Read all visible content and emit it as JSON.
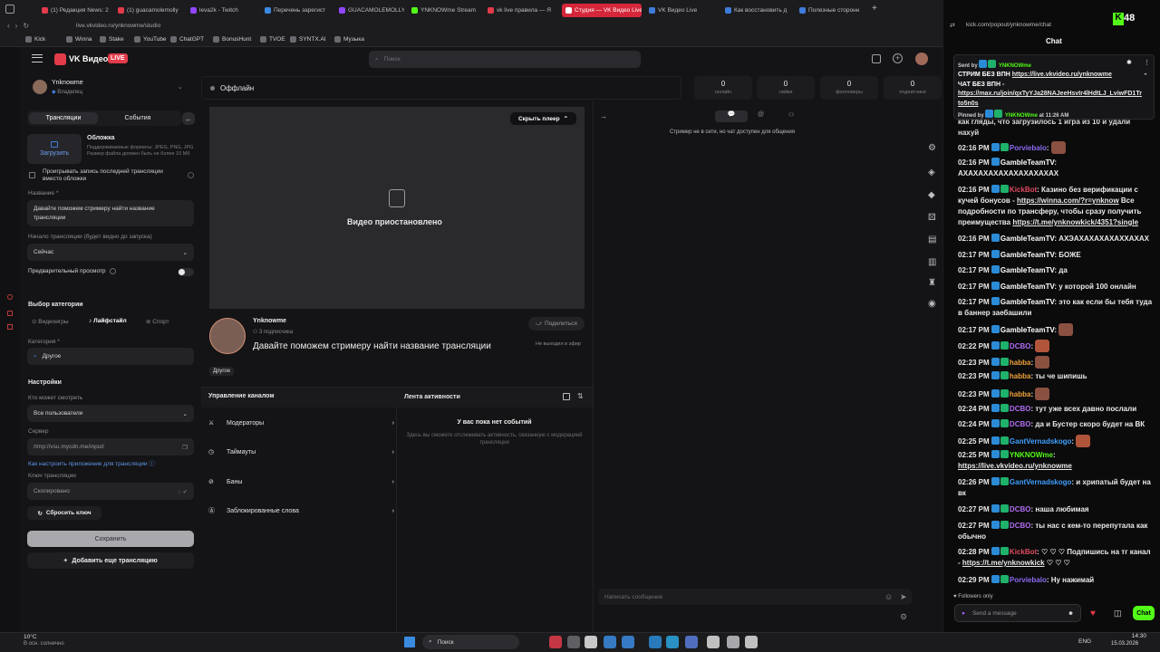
{
  "browser": {
    "tabs": [
      {
        "label": "(1) Редакция News: 2"
      },
      {
        "label": "(1) guacamolemolly"
      },
      {
        "label": "leva2k - Twitch"
      },
      {
        "label": "Перечень зарегист"
      },
      {
        "label": "GUACAMOLEMOLLY"
      },
      {
        "label": "YNKNOWme Stream"
      },
      {
        "label": "vk live правила — Я"
      },
      {
        "label": "Студия — VK Видео Live"
      },
      {
        "label": "VK Видео Live"
      },
      {
        "label": "Как восстановить д"
      },
      {
        "label": "Полезные сторонн"
      }
    ],
    "address": "live.vkvideo.ru/ynknowme/studio",
    "bookmarks": [
      "Kick",
      "Winna",
      "Stake",
      "YouTube",
      "ChatGPT",
      "BonusHunt",
      "TVOE",
      "SYNTX.AI",
      "Музыка"
    ],
    "colors": {
      "accent": "#d6263a",
      "kick": "#53fc18"
    }
  },
  "studio": {
    "logo": "VK Видео",
    "live_badge": "LIVE",
    "search_placeholder": "Поиск",
    "channel": {
      "name": "Ynknowme",
      "role": "Владелец"
    },
    "status": "Оффлайн",
    "stats": [
      {
        "value": "0",
        "label": "онлайн"
      },
      {
        "value": "0",
        "label": "лайки"
      },
      {
        "value": "0",
        "label": "фолловеры"
      },
      {
        "value": "0",
        "label": "подписчики"
      }
    ],
    "tabs": {
      "broadcasts": "Трансляции",
      "events": "События"
    },
    "cover": {
      "title": "Обложка",
      "upload": "Загрузить",
      "hint": "Поддерживаемые форматы: JPEG, PNG, JPG Размер файла должен быть не более 10 Мб"
    },
    "play_last_label": "Проигрывать запись последней трансляции вместо обложки",
    "title_label": "Название *",
    "title_value": "Давайте поможем стримеру найти название трансляции",
    "start_label": "Начало трансляции (будет видно до запуска)",
    "start_value": "Сейчас",
    "preview_label": "Предварительный просмотр",
    "category_section": "Выбор категории",
    "category_tabs": [
      "Видеоигры",
      "Лайфстайл",
      "Спорт"
    ],
    "category_label": "Категория *",
    "category_value": "Другое",
    "settings_title": "Настройки",
    "who_label": "Кто может смотреть",
    "who_value": "Все пользователи",
    "server_label": "Сервер",
    "server_value": "rtmp://vsu.mycdn.me/input/",
    "howto_link": "Как настроить приложение для трансляции",
    "key_label": "Ключ трансляции",
    "key_value": "Скопировано",
    "reset_key": "Сбросить ключ",
    "save": "Сохранить",
    "add_broadcast": "Добавить еще трансляцию",
    "player": {
      "hide_player": "Скрыть плеер",
      "paused": "Видео приостановлено",
      "streamer": "Ynknowme",
      "subs": "3 подписчика",
      "share": "Поделиться",
      "not_live": "Не выходил в эфир",
      "stream_title": "Давайте поможем стримеру найти название трансляции",
      "tag": "Другое"
    },
    "manage": {
      "title": "Управление каналом",
      "items": [
        "Модераторы",
        "Таймауты",
        "Баны",
        "Заблокированные слова"
      ]
    },
    "activity": {
      "title": "Лента активности",
      "empty_title": "У вас пока нет событий",
      "empty_text": "Здесь вы сможете отслеживать активность, связанную с модерацией трансляции"
    },
    "chat": {
      "offline_note": "Стример не в сети, но чат доступен для общения",
      "input_placeholder": "Написать сообщение"
    }
  },
  "kick": {
    "address": "kick.com/popout/ynknowme/chat",
    "badge_number": "48",
    "title": "Chat",
    "pinned": {
      "sent_by": "Sent by",
      "sender": "YNKNOWme",
      "line1": "СТРИМ БЕЗ ВПН",
      "link1": "https://live.vkvideo.ru/ynknowme",
      "line2": "ЧАТ",
      "line2b": "ЧАТ БЕЗ ВПН -",
      "link2": "https://max.ru/join/qxTyYJa28NAJeeHsvIr4lHdtLJ_LviwFD1Trto5n0s",
      "pinned_by": "Pinned by",
      "pinned_user": "YNKNOWme",
      "pinned_time": "at 11:26 AM"
    },
    "partial_top": "как гляды, что загрузилось 1 игра из 10 и удали нахуй",
    "messages": [
      {
        "time": "02:16 PM",
        "user": "Porviebalo",
        "color": "#8b6cf0",
        "text": ""
      },
      {
        "time": "02:16 PM",
        "user": "GambleTeamTV",
        "color": "#ffffff",
        "text": "АХАХАХАХАХАХАХАХАХАХ"
      },
      {
        "time": "02:16 PM",
        "user": "KickBot",
        "color": "#e04a5f",
        "text": "Казино без верификации с кучей бонусов -",
        "link": "https://winna.com/?r=ynknow",
        "text2": "Все подробности по трансферу, чтобы сразу получить преимущества",
        "link2": "https://t.me/ynknowkick/4351?single"
      },
      {
        "time": "02:16 PM",
        "user": "GambleTeamTV",
        "color": "#ffffff",
        "text": "АХЭАХАХАХАХАХХАХАХ"
      },
      {
        "time": "02:17 PM",
        "user": "GambleTeamTV",
        "color": "#ffffff",
        "text": "БОЖЕ"
      },
      {
        "time": "02:17 PM",
        "user": "GambleTeamTV",
        "color": "#ffffff",
        "text": "да"
      },
      {
        "time": "02:17 PM",
        "user": "GambleTeamTV",
        "color": "#ffffff",
        "text": "у которой 100 онлайн"
      },
      {
        "time": "02:17 PM",
        "user": "GambleTeamTV",
        "color": "#ffffff",
        "text": "это как если бы тебя туда в баннер заебашили"
      },
      {
        "time": "02:17 PM",
        "user": "GambleTeamTV",
        "color": "#ffffff",
        "text": ""
      },
      {
        "time": "02:22 PM",
        "user": "DCBO",
        "color": "#b06cf0",
        "text": ""
      },
      {
        "time": "02:23 PM",
        "user": "habba",
        "color": "#f0a23c",
        "text": ""
      },
      {
        "time": "02:23 PM",
        "user": "habba",
        "color": "#f0a23c",
        "text": "ты че шипишь"
      },
      {
        "time": "02:23 PM",
        "user": "habba",
        "color": "#f0a23c",
        "text": ""
      },
      {
        "time": "02:24 PM",
        "user": "DCBO",
        "color": "#b06cf0",
        "text": "тут уже всех давно послали"
      },
      {
        "time": "02:24 PM",
        "user": "DCBO",
        "color": "#b06cf0",
        "text": "да и Бустер скоро будет на ВК"
      },
      {
        "time": "02:25 PM",
        "user": "GantVernadskogo",
        "color": "#3fa0ff",
        "text": ""
      },
      {
        "time": "02:25 PM",
        "user": "YNKNOWme",
        "color": "#53fc18",
        "text": "",
        "link": "https://live.vkvideo.ru/ynknowme"
      },
      {
        "time": "02:26 PM",
        "user": "GantVernadskogo",
        "color": "#3fa0ff",
        "text": "и хрипатый будет на вк"
      },
      {
        "time": "02:27 PM",
        "user": "DCBO",
        "color": "#b06cf0",
        "text": "наша любимая"
      },
      {
        "time": "02:27 PM",
        "user": "DCBO",
        "color": "#b06cf0",
        "text": "ты нас с кем-то перепутала как обычно"
      },
      {
        "time": "02:28 PM",
        "user": "KickBot",
        "color": "#e04a5f",
        "text": "♡ ♡ ♡ Подпишись на тг канал -",
        "link": "https://t.me/ynknowkick",
        "text2": "♡ ♡ ♡"
      },
      {
        "time": "02:29 PM",
        "user": "Porviebalo",
        "color": "#8b6cf0",
        "text": "Ну нажимай"
      }
    ],
    "followers_only": "Followers only",
    "send_placeholder": "Send a message",
    "chat_button": "Chat"
  },
  "taskbar": {
    "weather_temp": "10°C",
    "weather_desc": "В осн. солнечно",
    "search": "Поиск",
    "lang": "ENG",
    "time": "14:30",
    "date": "15.03.2026"
  }
}
